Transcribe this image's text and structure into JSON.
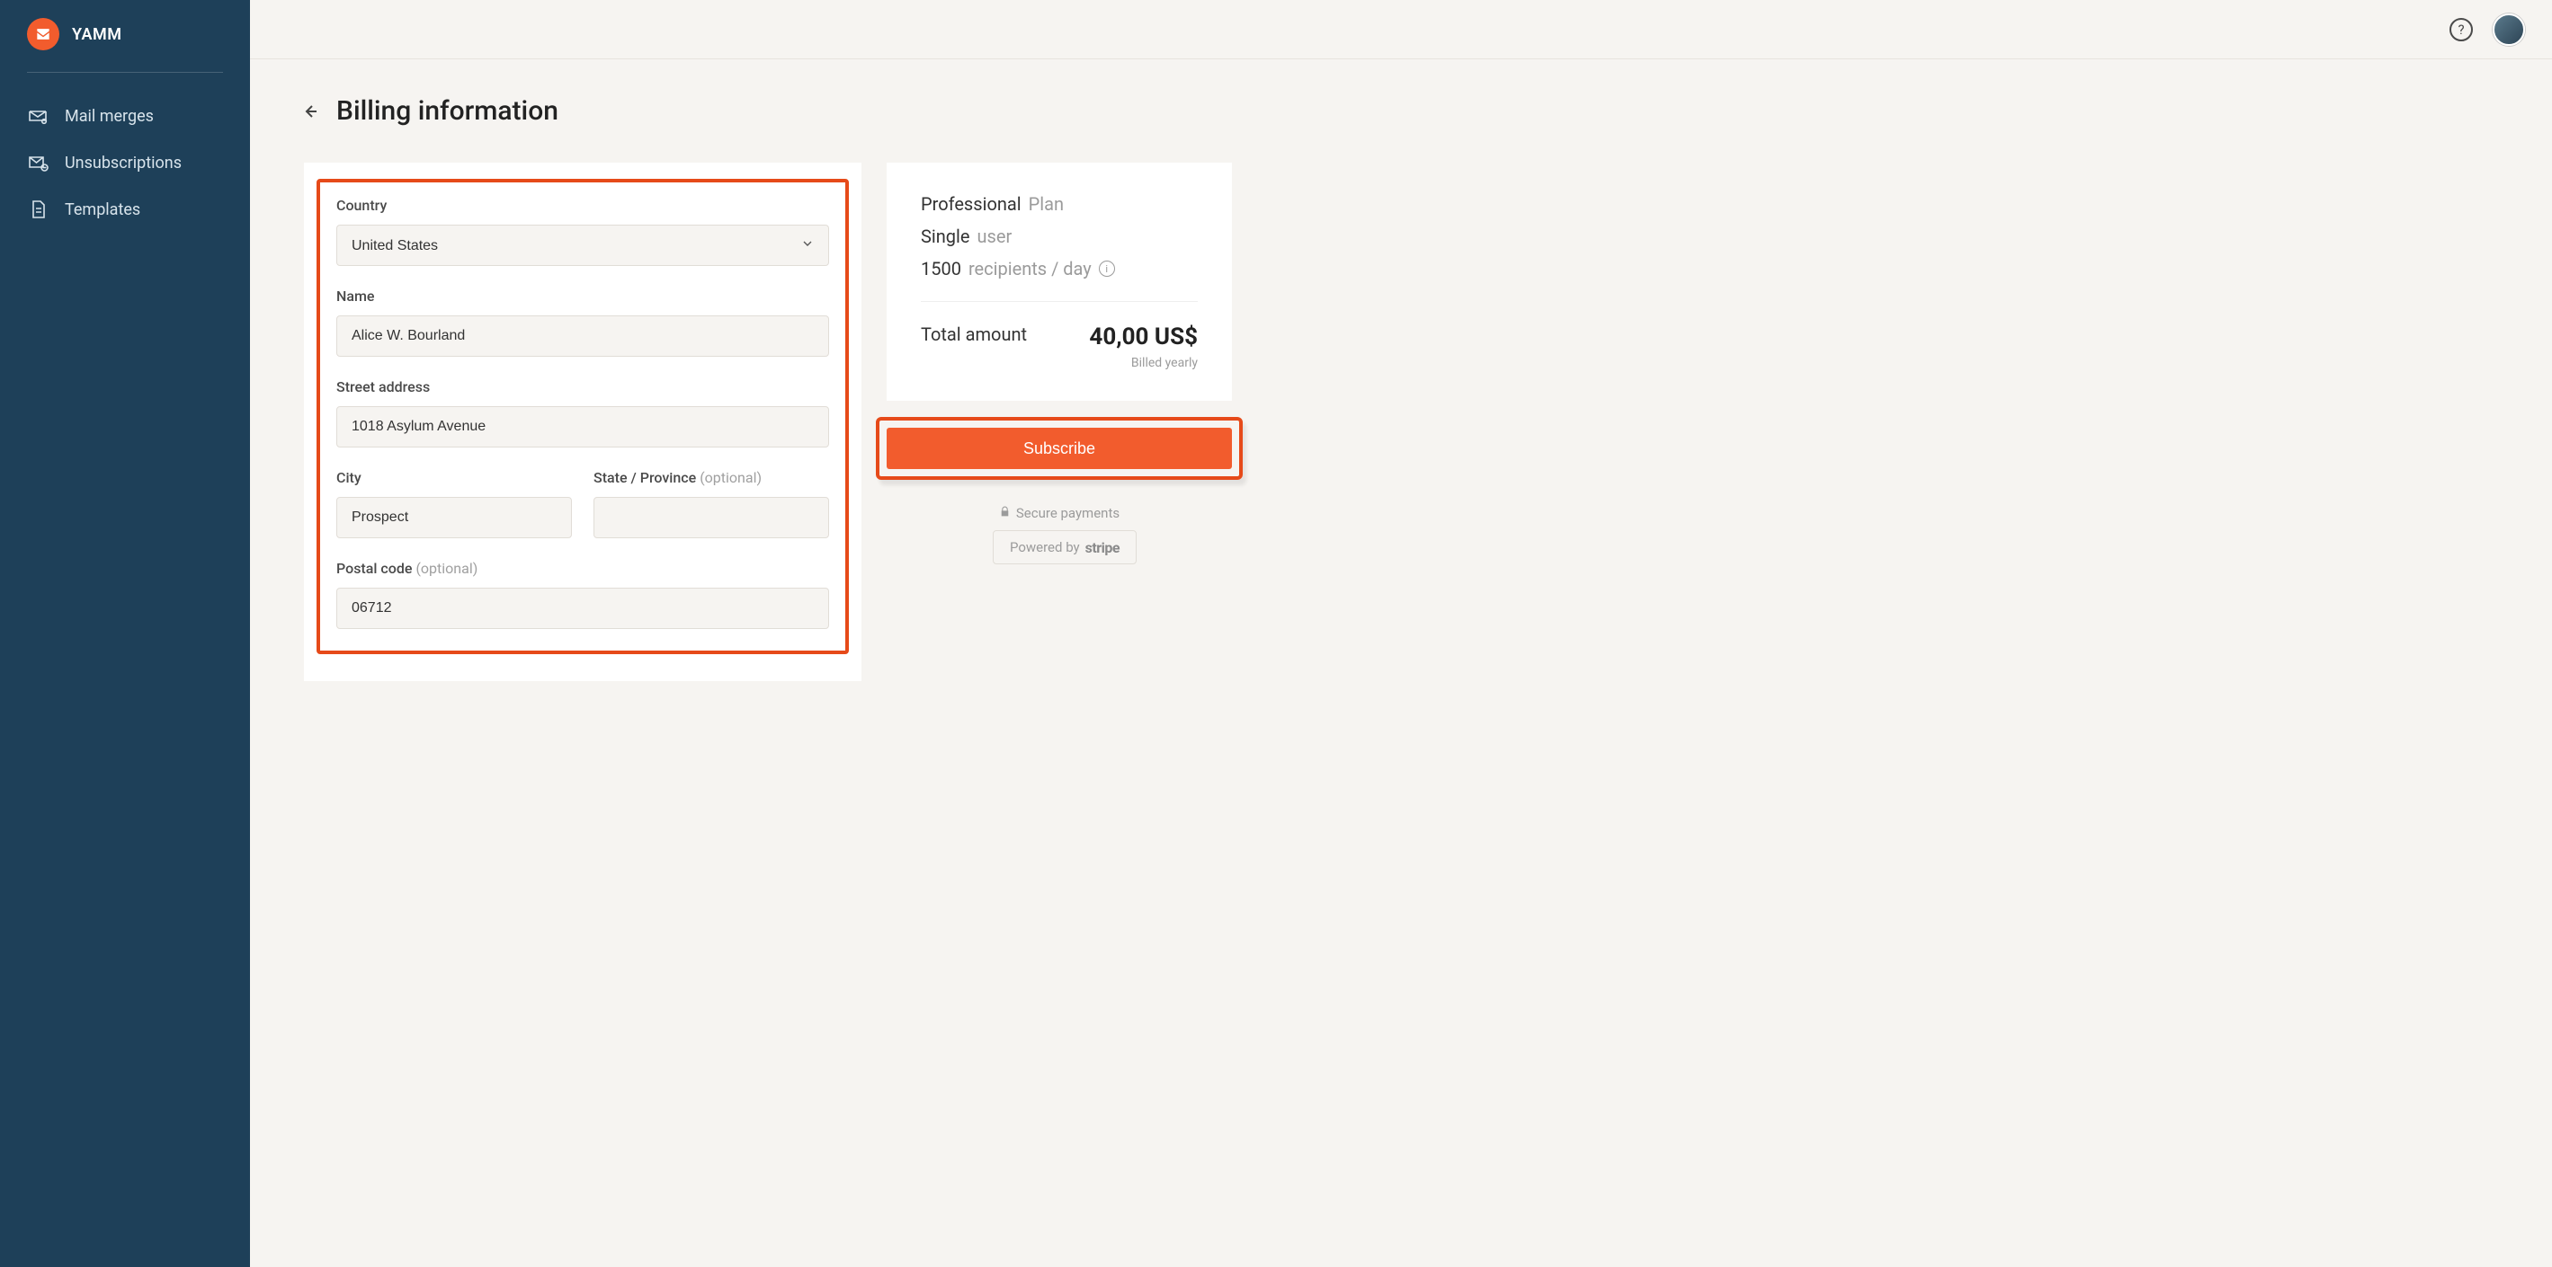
{
  "brand": {
    "name": "YAMM"
  },
  "sidebar": {
    "items": [
      {
        "label": "Mail merges"
      },
      {
        "label": "Unsubscriptions"
      },
      {
        "label": "Templates"
      }
    ]
  },
  "page": {
    "title": "Billing information"
  },
  "form": {
    "country_label": "Country",
    "country_value": "United States",
    "name_label": "Name",
    "name_value": "Alice W. Bourland",
    "street_label": "Street address",
    "street_value": "1018 Asylum Avenue",
    "city_label": "City",
    "city_value": "Prospect",
    "state_label": "State / Province",
    "state_optional": "(optional)",
    "state_value": "",
    "postal_label": "Postal code",
    "postal_optional": "(optional)",
    "postal_value": "06712"
  },
  "summary": {
    "plan_name": "Professional",
    "plan_suffix": "Plan",
    "seat_name": "Single",
    "seat_suffix": "user",
    "quota_value": "1500",
    "quota_suffix": "recipients / day",
    "total_label": "Total amount",
    "total_amount": "40,00 US$",
    "billed": "Billed yearly",
    "subscribe_label": "Subscribe",
    "secure_text": "Secure payments",
    "powered_prefix": "Powered by",
    "powered_brand": "stripe"
  }
}
